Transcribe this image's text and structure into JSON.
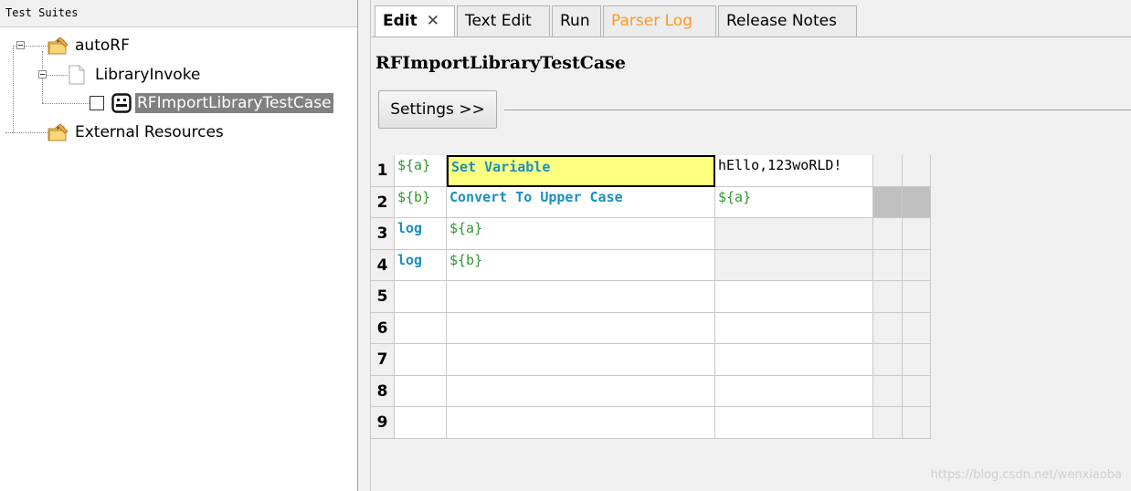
{
  "tree": {
    "header": "Test Suites",
    "nodes": [
      {
        "label": "autoRF",
        "icon": "folder-edit-icon"
      },
      {
        "label": "LibraryInvoke",
        "icon": "file-icon"
      },
      {
        "label": "RFImportLibraryTestCase",
        "icon": "robot-icon",
        "selected": true
      },
      {
        "label": "External Resources",
        "icon": "folder-edit-icon"
      }
    ]
  },
  "tabs": [
    {
      "label": "Edit",
      "active": true,
      "closable": true
    },
    {
      "label": "Text Edit"
    },
    {
      "label": "Run"
    },
    {
      "label": "Parser Log",
      "color": "#ff9a1f"
    },
    {
      "label": "Release Notes"
    }
  ],
  "editor": {
    "title": "RFImportLibraryTestCase",
    "settings_label": "Settings >>"
  },
  "grid": {
    "rows": [
      {
        "num": "1",
        "c1": "${a}",
        "c2": "Set Variable",
        "c3": "hEllo,123woRLD!"
      },
      {
        "num": "2",
        "c1": "${b}",
        "c2": "Convert To Upper Case",
        "c3": "${a}"
      },
      {
        "num": "3",
        "c1": "log",
        "c2": "${a}",
        "c3": ""
      },
      {
        "num": "4",
        "c1": "log",
        "c2": "${b}",
        "c3": ""
      },
      {
        "num": "5",
        "c1": "",
        "c2": "",
        "c3": ""
      },
      {
        "num": "6",
        "c1": "",
        "c2": "",
        "c3": ""
      },
      {
        "num": "7",
        "c1": "",
        "c2": "",
        "c3": ""
      },
      {
        "num": "8",
        "c1": "",
        "c2": "",
        "c3": ""
      },
      {
        "num": "9",
        "c1": "",
        "c2": "",
        "c3": ""
      }
    ]
  },
  "colors": {
    "variable": "#2e9a2e",
    "keyword": "#1a8fbf",
    "selected_cell": "#ffff80"
  },
  "watermark": "https://blog.csdn.net/wenxiaoba"
}
